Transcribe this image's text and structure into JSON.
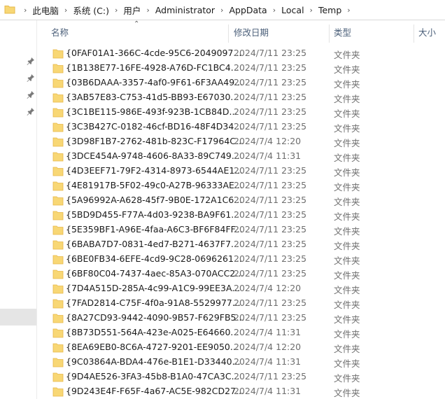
{
  "address_bar": {
    "crumbs": [
      "此电脑",
      "系统 (C:)",
      "用户",
      "Administrator",
      "AppData",
      "Local",
      "Temp"
    ]
  },
  "columns": {
    "name": "名称",
    "date": "修改日期",
    "type": "类型",
    "size": "大小"
  },
  "colors": {
    "folder": "#f8d775",
    "folder_edge": "#e6b84a",
    "selection": "#e5e5e5",
    "header_text": "#4c607a"
  },
  "rows": [
    {
      "name": "{0FAF01A1-366C-4cde-95C6-2049097...",
      "date": "2024/7/11 23:25",
      "type": "文件夹"
    },
    {
      "name": "{1B138E77-16FE-4928-A76D-FC1BC4...",
      "date": "2024/7/11 23:25",
      "type": "文件夹"
    },
    {
      "name": "{03B6DAAA-3357-4af0-9F61-6F3AA49...",
      "date": "2024/7/11 23:25",
      "type": "文件夹"
    },
    {
      "name": "{3AB57E83-C753-41d5-BB93-E67030...",
      "date": "2024/7/11 23:25",
      "type": "文件夹"
    },
    {
      "name": "{3C1BE115-986E-493f-923B-1CB84D...",
      "date": "2024/7/11 23:25",
      "type": "文件夹"
    },
    {
      "name": "{3C3B427C-0182-46cf-BD16-48F4D34...",
      "date": "2024/7/11 23:25",
      "type": "文件夹"
    },
    {
      "name": "{3D98F1B7-2762-481b-823C-F17964C...",
      "date": "2024/7/4 12:20",
      "type": "文件夹"
    },
    {
      "name": "{3DCE454A-9748-4606-8A33-89C749...",
      "date": "2024/7/4 11:31",
      "type": "文件夹"
    },
    {
      "name": "{4D3EEF71-79F2-4314-8973-6544AE1...",
      "date": "2024/7/11 23:25",
      "type": "文件夹"
    },
    {
      "name": "{4E81917B-5F02-49c0-A27B-96333AE...",
      "date": "2024/7/11 23:25",
      "type": "文件夹"
    },
    {
      "name": "{5A96992A-A628-45f7-9B0E-172A1C6...",
      "date": "2024/7/11 23:25",
      "type": "文件夹"
    },
    {
      "name": "{5BD9D455-F77A-4d03-9238-BA9F61...",
      "date": "2024/7/11 23:25",
      "type": "文件夹"
    },
    {
      "name": "{5E359BF1-A96E-4faa-A6C3-BF6F84FF...",
      "date": "2024/7/11 23:25",
      "type": "文件夹"
    },
    {
      "name": "{6BABA7D7-0831-4ed7-B271-4637F7...",
      "date": "2024/7/11 23:25",
      "type": "文件夹"
    },
    {
      "name": "{6BE0FB34-6EFE-4cd9-9C28-0696261...",
      "date": "2024/7/11 23:25",
      "type": "文件夹"
    },
    {
      "name": "{6BF80C04-7437-4aec-85A3-070ACC2...",
      "date": "2024/7/11 23:25",
      "type": "文件夹"
    },
    {
      "name": "{7D4A515D-285A-4c99-A1C9-99EE3A...",
      "date": "2024/7/4 12:20",
      "type": "文件夹"
    },
    {
      "name": "{7FAD2814-C75F-4f0a-91A8-5529977...",
      "date": "2024/7/11 23:25",
      "type": "文件夹"
    },
    {
      "name": "{8A27CD93-9442-4090-9B57-F629FB5...",
      "date": "2024/7/11 23:25",
      "type": "文件夹"
    },
    {
      "name": "{8B73D551-564A-423e-A025-E64660...",
      "date": "2024/7/4 11:31",
      "type": "文件夹"
    },
    {
      "name": "{8EA69EB0-8C6A-4727-9201-EE9050...",
      "date": "2024/7/4 12:20",
      "type": "文件夹"
    },
    {
      "name": "{9C03864A-BDA4-476e-B1E1-D33440...",
      "date": "2024/7/4 11:31",
      "type": "文件夹"
    },
    {
      "name": "{9D4AE526-3FA3-45b8-B1A0-47CA3C...",
      "date": "2024/7/11 23:25",
      "type": "文件夹"
    },
    {
      "name": "{9D243E4F-F65F-4a67-AC5E-982CD27...",
      "date": "2024/7/4 11:31",
      "type": "文件夹"
    }
  ]
}
